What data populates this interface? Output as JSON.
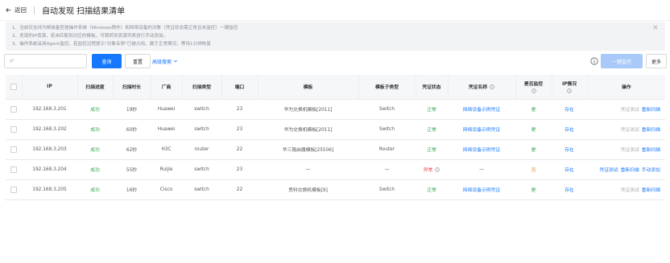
{
  "header": {
    "back_label": "返回",
    "title": "自动发现 扫描结果清单"
  },
  "notice": {
    "line1": "1、当前仅支持为柳装备型是操作系统（Windows除外）和网络设备的对象（凭证状态需正常且未监控）一键监控",
    "line2": "2、发现的IP资源，若未匹配到对应的模板，可跳转到资源列表进行手动添加。",
    "line3": "3、操作系统采用Agent监控，若监控过程提示\"对象名称\"已被占用，属于正常情况，等待1分钟恢复"
  },
  "toolbar": {
    "ip_placeholder": "IP",
    "query_label": "查询",
    "reset_label": "重置",
    "advanced_label": "高级搜索",
    "monitor_label": "一键监控",
    "more_label": "更多"
  },
  "table": {
    "headers": {
      "ip": "IP",
      "progress": "扫描进度",
      "duration": "扫描时长",
      "vendor": "厂商",
      "scan_type": "扫描类型",
      "port": "端口",
      "template": "模板",
      "template_sub": "模板子类型",
      "cred_status": "凭证状态",
      "cred_name": "凭证名称",
      "monitored": "是否监控",
      "ip_status": "IP情况",
      "actions": "操作"
    },
    "rows": [
      {
        "ip": "192.168.3.201",
        "progress": "成功",
        "duration": "19秒",
        "vendor": "Huawei",
        "scan_type": "switch",
        "port": "23",
        "template": "华为交换机模板[2011]",
        "template_sub": "Switch",
        "cred_status": "正常",
        "cred_name": "网络设备示例凭证",
        "monitored": "是",
        "ip_status": "存在",
        "actions": [
          "凭证测试",
          "重新扫描"
        ]
      },
      {
        "ip": "192.168.3.202",
        "progress": "成功",
        "duration": "60秒",
        "vendor": "Huawei",
        "scan_type": "switch",
        "port": "23",
        "template": "华为交换机模板[2011]",
        "template_sub": "Switch",
        "cred_status": "正常",
        "cred_name": "网络设备示例凭证",
        "monitored": "是",
        "ip_status": "存在",
        "actions": [
          "凭证测试",
          "重新扫描"
        ]
      },
      {
        "ip": "192.168.3.203",
        "progress": "成功",
        "duration": "62秒",
        "vendor": "H3C",
        "scan_type": "router",
        "port": "22",
        "template": "华三路由器模板[25506]",
        "template_sub": "Router",
        "cred_status": "正常",
        "cred_name": "网络设备示例凭证",
        "monitored": "是",
        "ip_status": "存在",
        "actions": [
          "凭证测试",
          "重新扫描"
        ]
      },
      {
        "ip": "192.168.3.204",
        "progress": "成功",
        "duration": "55秒",
        "vendor": "Ruijie",
        "scan_type": "switch",
        "port": "23",
        "template": "—",
        "template_sub": "—",
        "cred_status": "异常",
        "cred_name": "—",
        "monitored": "否",
        "ip_status": "存在",
        "actions": [
          "凭证测试",
          "重新扫描",
          "手动添加"
        ]
      },
      {
        "ip": "192.168.3.205",
        "progress": "成功",
        "duration": "16秒",
        "vendor": "Cisco",
        "scan_type": "switch",
        "port": "22",
        "template": "思科交换机模板[9]",
        "template_sub": "Switch",
        "cred_status": "正常",
        "cred_name": "网络设备示例凭证",
        "monitored": "是",
        "ip_status": "存在",
        "actions": [
          "凭证测试",
          "重新扫描"
        ]
      }
    ]
  },
  "colors": {
    "primary": "#1677ff",
    "success": "#2fa84f",
    "error": "#e5484d",
    "warning": "#f08a24",
    "disabled_button": "#a9c9f8"
  },
  "icons": {
    "back": "arrow-left-icon",
    "close": "close-icon",
    "advanced": "chevron-down-icon",
    "info": "info-circle-icon"
  }
}
